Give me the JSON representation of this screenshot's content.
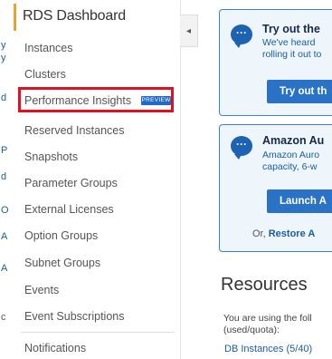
{
  "edge_fragments": [
    "y",
    "y",
    "d",
    "P",
    "d",
    "O",
    "A",
    "A",
    "c"
  ],
  "sidebar": {
    "title": "RDS Dashboard",
    "items": [
      {
        "label": "Instances"
      },
      {
        "label": "Clusters"
      },
      {
        "label": "Performance Insights",
        "badge": "PREVIEW"
      },
      {
        "label": "Reserved Instances"
      },
      {
        "label": "Snapshots"
      },
      {
        "label": "Parameter Groups"
      },
      {
        "label": "External Licenses"
      },
      {
        "label": "Option Groups"
      },
      {
        "label": "Subnet Groups"
      },
      {
        "label": "Events"
      },
      {
        "label": "Event Subscriptions"
      },
      {
        "label": "Notifications"
      }
    ]
  },
  "collapse": {
    "glyph": "◂"
  },
  "cards": [
    {
      "icon": "chat-bubble-icon",
      "title": "Try out the",
      "lines": [
        "We've heard",
        "rolling it out to"
      ],
      "button": "Try out th"
    },
    {
      "icon": "chat-bubble-icon",
      "title": "Amazon Au",
      "lines": [
        "Amazon Auro",
        "capacity, 6-w"
      ],
      "button": "Launch A",
      "footer_prefix": "Or,",
      "footer_link": "Restore A"
    }
  ],
  "resources": {
    "title": "Resources",
    "text_lines": [
      "You are using the foll",
      "(used/quota):"
    ],
    "link": "DB Instances (5/40)"
  },
  "colors": {
    "accent": "#f0a030",
    "highlight_box": "#e0101e",
    "badge": "#1f69c8",
    "card_border": "#3f82c4",
    "card_bg": "#eef5fb",
    "button": "#2a72c6",
    "link": "#1a5ea8"
  }
}
